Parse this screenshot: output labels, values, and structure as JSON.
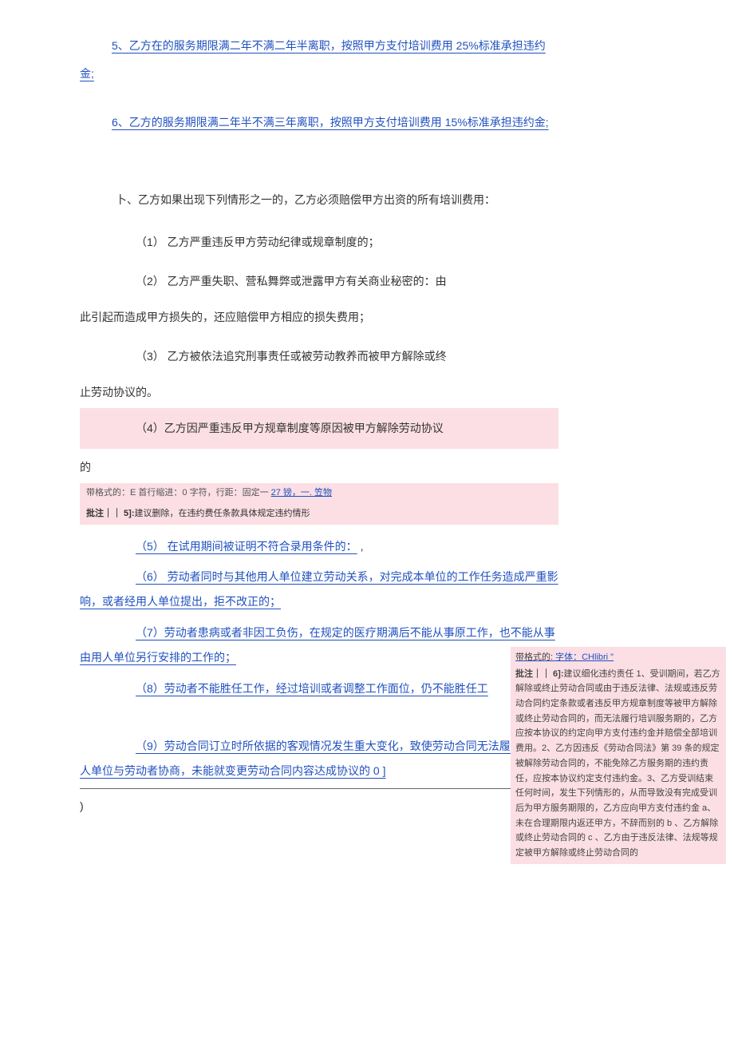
{
  "top": {
    "item5": "5、乙方在的服务期限满二年不满二年半离职，按照甲方支付培训费用 25%标准承担违约金;",
    "item6": "6、乙方的服务期限满二年半不满三年离职，按照甲方支付培训费用 15%标准承担违约金;"
  },
  "sectionB": {
    "intro": "卜、乙方如果出现下列情形之一的，乙方必须赔偿甲方出资的所有培训费用：",
    "i1": "（1） 乙方严重违反甲方劳动纪律或规章制度的；",
    "i2a": "（2） 乙方严重失职、营私舞弊或泄露甲方有关商业秘密的：由",
    "i2b": "此引起而造成甲方损失的，还应赔偿甲方相应的损失费用；",
    "i3a": "（3） 乙方被依法追究刑事责任或被劳动教养而被甲方解除或终",
    "i3b": "止劳动协议的。",
    "i4a": "（4）乙方因严重违反甲方规章制度等原因被甲方解除劳动协议",
    "i4b": "的"
  },
  "formatBox": {
    "prefix": "带格式的：E ",
    "middle": "首行缩进：0 字符，行距：固定一 ",
    "link": "27 镑，一. 笠物"
  },
  "commentInline": {
    "prefix": "批注｜｜ 5]:",
    "text": "建议删除，在违约费任条款具体规定违约情形"
  },
  "items": {
    "i5": "（5） 在试用期间被证明不符合录用条件的：",
    "i6": "（6） 劳动者同时与其他用人单位建立劳动关系，对完成本单位的工作任务造成严重影响，或者经用人单位提出，拒不改正的；",
    "i7": "（7）劳动者患病或者非因工负伤，在规定的医疗期满后不能从事原工作，也不能从事由用人单位另行安排的工作的；",
    "i8": "（8）劳动者不能胜任工作，经过培训或者调整工作面位，仍不能胜任工",
    "i9": "（9）劳动合同订立时所依据的客观情况发生重大变化，致使劳动合同无法履行，经用人单位与劳动者协商，未能就变更劳动合同内容达成协议的 0 ]",
    "closeParen": ")"
  },
  "sidebar": {
    "hdrLabel": "带格式的:",
    "hdrVal": " 字体：CHlibri          \"",
    "commentLabel": "批注｜｜ 6]:",
    "commentText": "建议细化违约责任 1、受训期间，若乙方解除或终止劳动合同或由于违反法律、法规或违反劳动合同约定条款或者违反甲方规章制度等被甲方解除或终止劳动合同的，而无法履行培训服务期的，乙方应按本协议的约定向甲方支付违约金并赔偿全部培训费用。2、乙方因违反《劳动合同法》第 39 条的规定被解除劳动合同的，不能免除乙方服务期的违约责任，应按本协议约定支付违约金。3、乙方受训结束任何时间，发生下列情形的，从而导致没有完成受训后为甲方服务期限的，乙方应向甲方支付违约金 a、未在合理期限内返还甲方，不辞而别的 b 、乙方解除或终止劳动合同的 c 、乙方由于违反法律、法规等规定被甲方解除或终止劳动合同的"
  }
}
